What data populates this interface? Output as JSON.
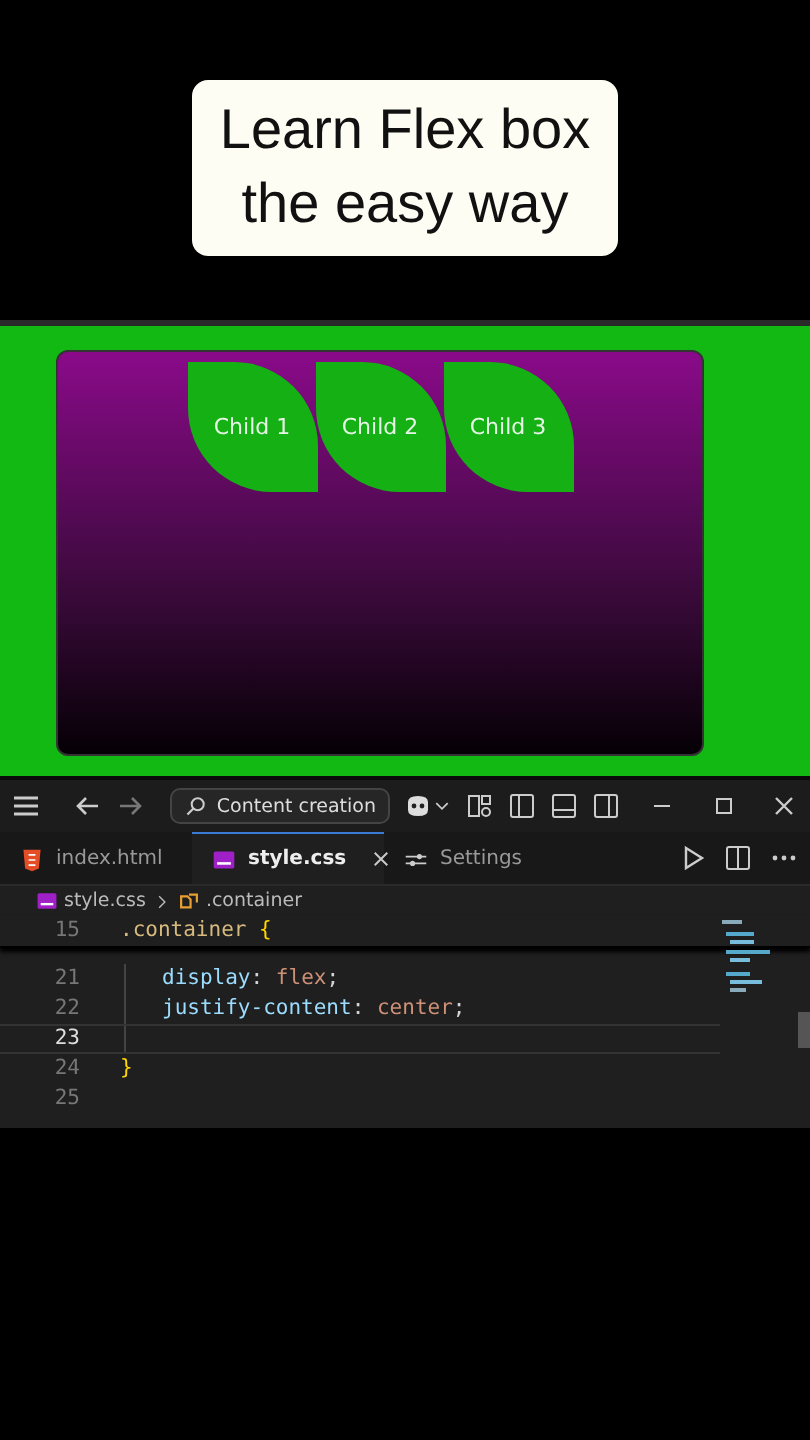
{
  "caption": {
    "lines": [
      "Learn Flex box",
      "the easy way"
    ]
  },
  "preview": {
    "children": [
      "Child 1",
      "Child 2",
      "Child 3"
    ]
  },
  "editor": {
    "search": {
      "placeholder": "Content creation"
    },
    "tabs": [
      {
        "label": "index.html",
        "kind": "html",
        "selected": false
      },
      {
        "label": "style.css",
        "kind": "css",
        "selected": true
      },
      {
        "label": "Settings",
        "kind": "settings",
        "selected": false
      }
    ],
    "breadcrumb": [
      {
        "label": "style.css",
        "kind": "css"
      },
      {
        "label": ".container",
        "kind": "symbol"
      }
    ],
    "lines": [
      {
        "number": "15",
        "kind": "sticky",
        "current": false,
        "tokens": [
          {
            "text": ".container",
            "kind": "selector"
          },
          {
            "text": " {",
            "kind": "brace"
          }
        ]
      },
      {
        "number": "21",
        "kind": "declaration",
        "current": false,
        "tokens": [
          {
            "text": "display",
            "kind": "property"
          },
          {
            "text": ": ",
            "kind": "punct"
          },
          {
            "text": "flex",
            "kind": "value"
          },
          {
            "text": ";",
            "kind": "punct"
          }
        ]
      },
      {
        "number": "22",
        "kind": "declaration",
        "current": false,
        "tokens": [
          {
            "text": "justify-content",
            "kind": "property"
          },
          {
            "text": ": ",
            "kind": "punct"
          },
          {
            "text": "center",
            "kind": "value"
          },
          {
            "text": ";",
            "kind": "punct"
          }
        ]
      },
      {
        "number": "23",
        "kind": "declaration",
        "current": true
      },
      {
        "number": "24",
        "kind": "rule",
        "current": false,
        "tokens": [
          {
            "text": "}",
            "kind": "brace"
          }
        ]
      },
      {
        "number": "25",
        "kind": "rule",
        "current": false
      }
    ]
  }
}
